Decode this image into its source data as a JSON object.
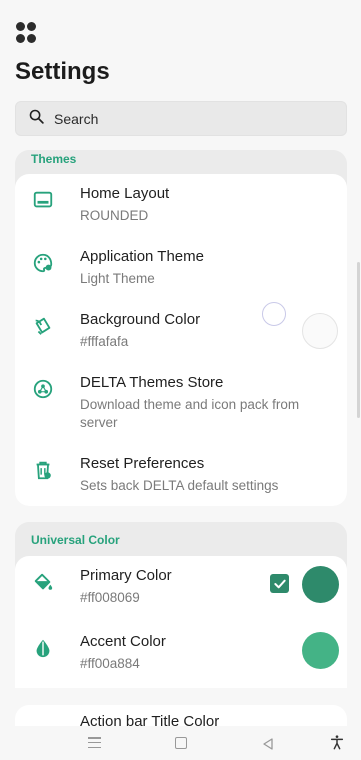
{
  "header": {
    "title": "Settings"
  },
  "search": {
    "placeholder": "Search"
  },
  "themes": {
    "header": "Themes",
    "items": [
      {
        "title": "Home Layout",
        "subtitle": "ROUNDED",
        "icon": "home-layout-icon"
      },
      {
        "title": "Application Theme",
        "subtitle": "Light Theme",
        "icon": "palette-icon"
      },
      {
        "title": "Background Color",
        "subtitle": "#fffafafa",
        "icon": "paint-bucket-icon"
      },
      {
        "title": "DELTA Themes Store",
        "subtitle": "Download theme and icon pack from server",
        "icon": "store-icon"
      },
      {
        "title": "Reset Preferences",
        "subtitle": "Sets back DELTA default settings",
        "icon": "reset-trash-icon"
      }
    ]
  },
  "universal": {
    "header": "Universal Color",
    "items": [
      {
        "title": "Primary Color",
        "subtitle": "#ff008069",
        "icon": "fill-bucket-icon",
        "swatch": "#2e8a6b",
        "checked": true
      },
      {
        "title": "Accent Color",
        "subtitle": "#ff00a884",
        "icon": "drop-icon",
        "swatch": "#44b386"
      }
    ],
    "partial_item_title": "Action bar Title Color"
  },
  "colors": {
    "accent": "#27a27c",
    "background_swatch": "#fafafa"
  }
}
